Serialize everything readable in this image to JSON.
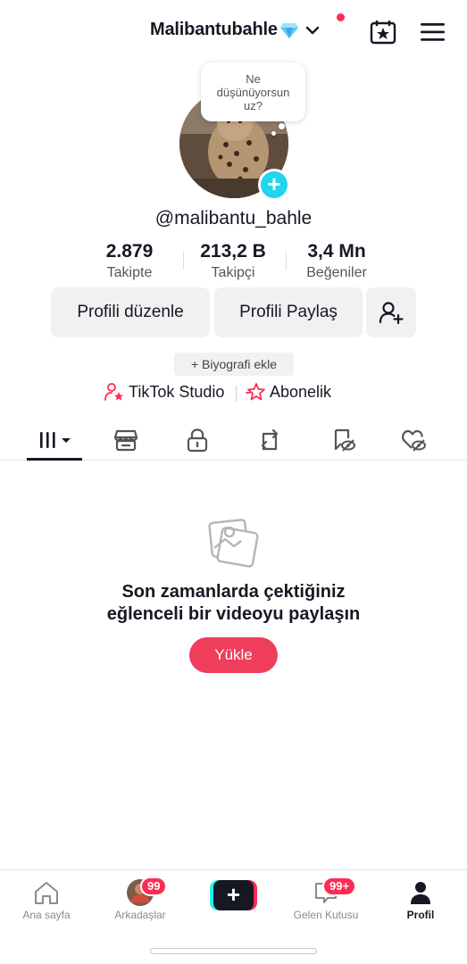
{
  "header": {
    "username": "Malibantubahle",
    "gem_icon": "diamond-icon",
    "notification_dot_color": "#fe2c55"
  },
  "profile": {
    "thought_bubble": "Ne düşünüyorsun uz?",
    "handle": "@malibantu_bahle",
    "stats": [
      {
        "value": "2.879",
        "label": "Takipte"
      },
      {
        "value": "213,2 B",
        "label": "Takipçi"
      },
      {
        "value": "3,4 Mn",
        "label": "Beğeniler"
      }
    ],
    "edit_button": "Profili düzenle",
    "share_button": "Profili Paylaş",
    "bio_chip": "+ Biyografi ekle",
    "studio_link": "TikTok Studio",
    "subscription_link": "Abonelik"
  },
  "tabs": [
    "videos-grid-icon",
    "shop-icon",
    "lock-icon",
    "repost-icon",
    "favorites-icon",
    "liked-icon"
  ],
  "empty_state": {
    "title_line1": "Son zamanlarda çektiğiniz",
    "title_line2": "eğlenceli bir videoyu paylaşın",
    "upload_button": "Yükle"
  },
  "bottom_nav": {
    "home": "Ana sayfa",
    "friends": "Arkadaşlar",
    "friends_badge": "99",
    "inbox": "Gelen Kutusu",
    "inbox_badge": "99+",
    "profile": "Profil"
  },
  "colors": {
    "accent": "#fe2c55",
    "upload": "#ee3e5b",
    "cyan": "#25f4ee"
  }
}
